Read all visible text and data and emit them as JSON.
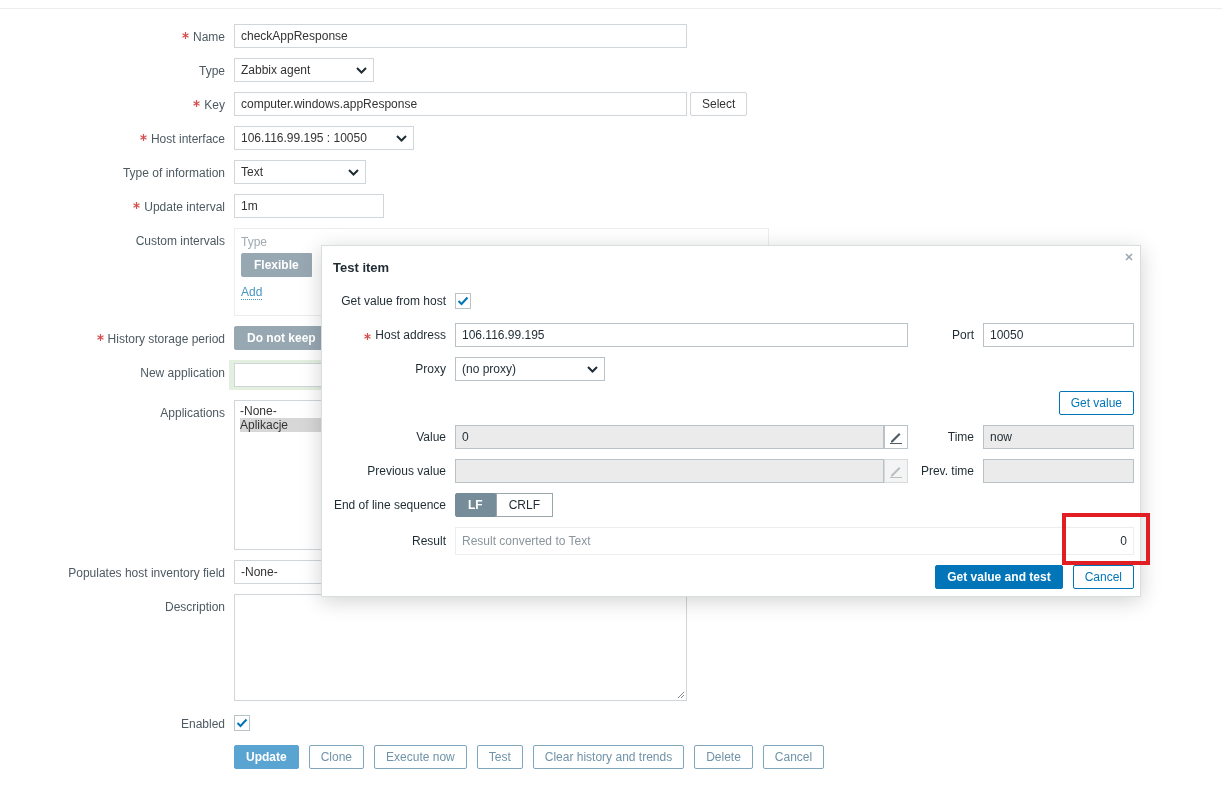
{
  "form": {
    "name": {
      "label": "Name",
      "required": true,
      "value": "checkAppResponse"
    },
    "type": {
      "label": "Type",
      "value": "Zabbix agent"
    },
    "key": {
      "label": "Key",
      "required": true,
      "value": "computer.windows.appResponse",
      "button": "Select"
    },
    "host_interface": {
      "label": "Host interface",
      "required": true,
      "value": "106.116.99.195 : 10050"
    },
    "type_of_information": {
      "label": "Type of information",
      "value": "Text"
    },
    "update_interval": {
      "label": "Update interval",
      "required": true,
      "value": "1m"
    },
    "custom_intervals": {
      "label": "Custom intervals",
      "columns": [
        "Type"
      ],
      "type_options": [
        {
          "label": "Flexible",
          "selected": true
        }
      ],
      "add_link": "Add"
    },
    "history_storage_period": {
      "label": "History storage period",
      "required": true,
      "options": [
        {
          "label": "Do not keep",
          "selected": true
        }
      ]
    },
    "new_application": {
      "label": "New application"
    },
    "applications": {
      "label": "Applications",
      "items": [
        {
          "label": "-None-",
          "selected": false
        },
        {
          "label": "Aplikacje",
          "selected": true
        }
      ]
    },
    "inventory_field": {
      "label": "Populates host inventory field",
      "value": "-None-"
    },
    "description": {
      "label": "Description"
    },
    "enabled": {
      "label": "Enabled",
      "checked": true
    },
    "buttons": [
      {
        "label": "Update",
        "kind": "primary"
      },
      {
        "label": "Clone",
        "kind": "secondary"
      },
      {
        "label": "Execute now",
        "kind": "secondary"
      },
      {
        "label": "Test",
        "kind": "secondary"
      },
      {
        "label": "Clear history and trends",
        "kind": "secondary"
      },
      {
        "label": "Delete",
        "kind": "secondary"
      },
      {
        "label": "Cancel",
        "kind": "secondary"
      }
    ]
  },
  "dialog": {
    "title": "Test item",
    "get_value_from_host": {
      "label": "Get value from host",
      "checked": true
    },
    "host_address": {
      "label": "Host address",
      "required": true,
      "value": "106.116.99.195"
    },
    "port": {
      "label": "Port",
      "value": "10050"
    },
    "proxy": {
      "label": "Proxy",
      "value": "(no proxy)"
    },
    "get_value_button": "Get value",
    "value": {
      "label": "Value",
      "value": "0",
      "edit_disabled": false
    },
    "time": {
      "label": "Time",
      "value": "now"
    },
    "previous_value": {
      "label": "Previous value",
      "edit_disabled": true
    },
    "prev_time": {
      "label": "Prev. time"
    },
    "eol": {
      "label": "End of line sequence",
      "options": [
        {
          "label": "LF",
          "selected": true
        },
        {
          "label": "CRLF",
          "selected": false
        }
      ]
    },
    "result": {
      "label": "Result",
      "hint": "Result converted to Text",
      "value": "0"
    },
    "buttons": [
      {
        "label": "Get value and test",
        "kind": "primary"
      },
      {
        "label": "Cancel",
        "kind": "secondary"
      }
    ]
  }
}
